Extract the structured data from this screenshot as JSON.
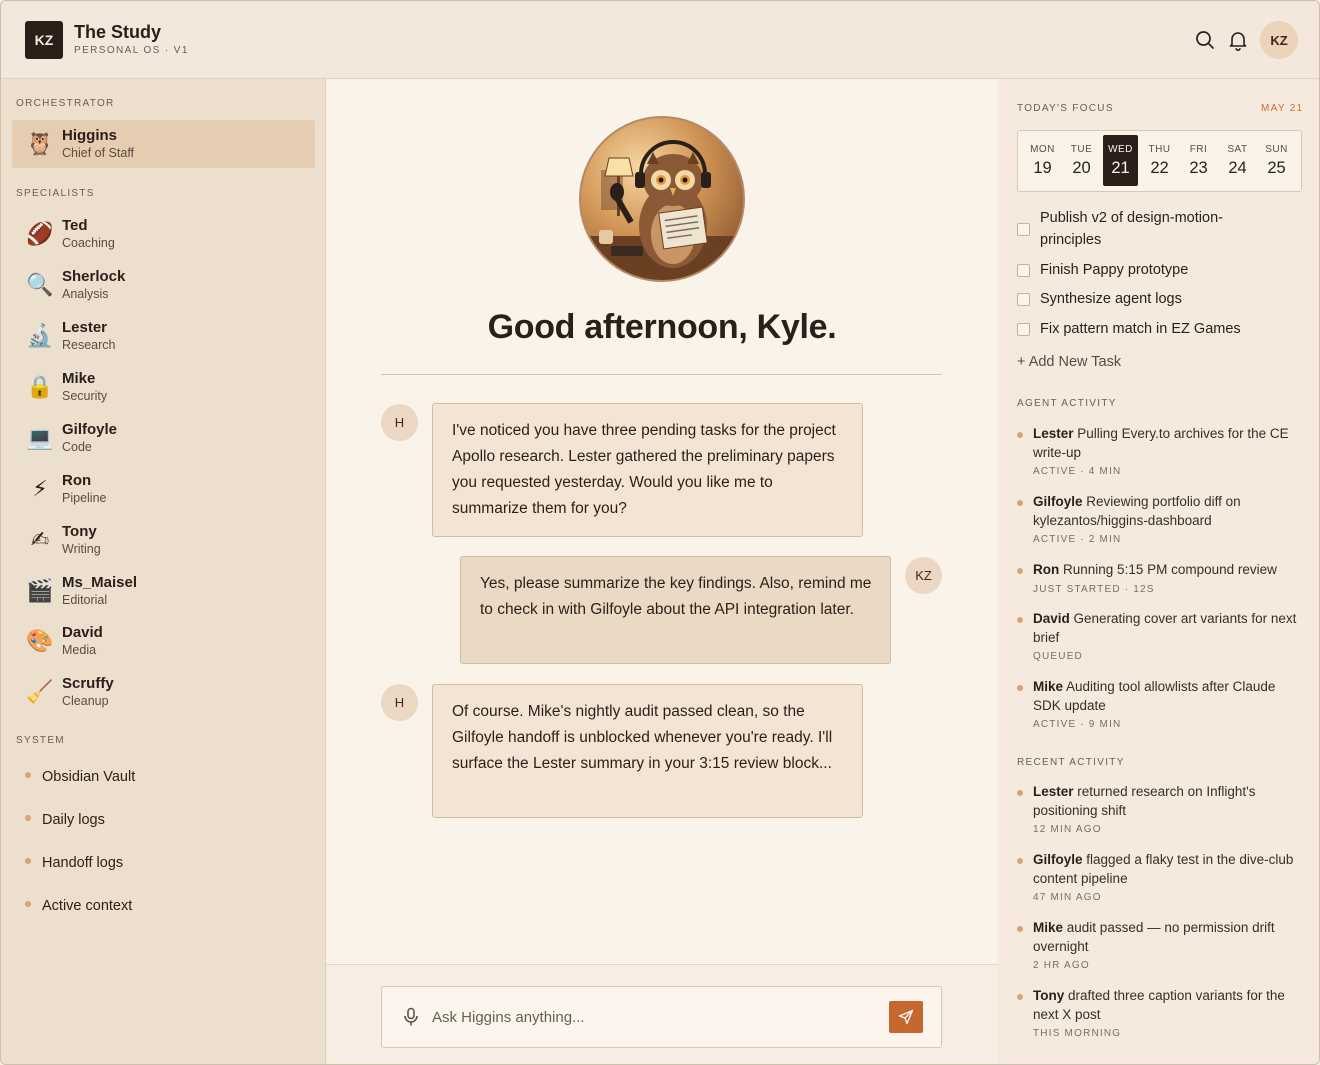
{
  "header": {
    "logo": "KZ",
    "title": "The Study",
    "subtitle": "PERSONAL OS · V1",
    "avatar": "KZ"
  },
  "sidebar": {
    "orchestrator_label": "ORCHESTRATOR",
    "orchestrator": {
      "name": "Higgins",
      "role": "Chief of Staff",
      "icon": "owl-icon"
    },
    "specialists_label": "SPECIALISTS",
    "specialists": [
      {
        "name": "Ted",
        "role": "Coaching",
        "icon": "football-icon"
      },
      {
        "name": "Sherlock",
        "role": "Analysis",
        "icon": "magnifier-icon"
      },
      {
        "name": "Lester",
        "role": "Research",
        "icon": "microscope-icon"
      },
      {
        "name": "Mike",
        "role": "Security",
        "icon": "lock-icon"
      },
      {
        "name": "Gilfoyle",
        "role": "Code",
        "icon": "laptop-icon"
      },
      {
        "name": "Ron",
        "role": "Pipeline",
        "icon": "lightning-icon"
      },
      {
        "name": "Tony",
        "role": "Writing",
        "icon": "writing-hand-icon"
      },
      {
        "name": "Ms_Maisel",
        "role": "Editorial",
        "icon": "clapper-icon"
      },
      {
        "name": "David",
        "role": "Media",
        "icon": "palette-icon"
      },
      {
        "name": "Scruffy",
        "role": "Cleanup",
        "icon": "broom-icon"
      }
    ],
    "system_label": "SYSTEM",
    "system": [
      "Obsidian Vault",
      "Daily logs",
      "Handoff logs",
      "Active context"
    ]
  },
  "main": {
    "greeting": "Good afternoon, Kyle.",
    "messages": [
      {
        "from": "H",
        "text": "I've noticed you have three pending tasks for the project Apollo research. Lester gathered the preliminary papers you requested yesterday. Would you like me to summarize them for you?"
      },
      {
        "from": "KZ",
        "text": "Yes, please summarize the key findings. Also, remind me to check in with Gilfoyle about the API integration later."
      },
      {
        "from": "H",
        "text": "Of course. Mike's nightly audit passed clean, so the Gilfoyle handoff is unblocked whenever you're ready. I'll surface the Lester summary in your 3:15 review block..."
      }
    ],
    "input_placeholder": "Ask Higgins anything..."
  },
  "right": {
    "focus_label": "TODAY'S FOCUS",
    "focus_date": "MAY 21",
    "days": [
      {
        "name": "MON",
        "num": "19"
      },
      {
        "name": "TUE",
        "num": "20"
      },
      {
        "name": "WED",
        "num": "21",
        "selected": true
      },
      {
        "name": "THU",
        "num": "22"
      },
      {
        "name": "FRI",
        "num": "23"
      },
      {
        "name": "SAT",
        "num": "24"
      },
      {
        "name": "SUN",
        "num": "25"
      }
    ],
    "tasks": [
      "Publish v2 of design-motion-principles",
      "Finish Pappy prototype",
      "Synthesize agent logs",
      "Fix pattern match in EZ Games"
    ],
    "add_task": "+ Add New Task",
    "agent_activity_label": "AGENT ACTIVITY",
    "agent_activity": [
      {
        "agent": "Lester",
        "text": "Pulling Every.to archives for the CE write-up",
        "meta": "ACTIVE · 4 MIN"
      },
      {
        "agent": "Gilfoyle",
        "text": "Reviewing portfolio diff on kylezantos/higgins-dashboard",
        "meta": "ACTIVE · 2 MIN"
      },
      {
        "agent": "Ron",
        "text": "Running 5:15 PM compound review",
        "meta": "JUST STARTED · 12S"
      },
      {
        "agent": "David",
        "text": "Generating cover art variants for next brief",
        "meta": "QUEUED"
      },
      {
        "agent": "Mike",
        "text": "Auditing tool allowlists after Claude SDK update",
        "meta": "ACTIVE · 9 MIN"
      }
    ],
    "recent_activity_label": "RECENT ACTIVITY",
    "recent_activity": [
      {
        "agent": "Lester",
        "text": "returned research on Inflight's positioning shift",
        "meta": "12 MIN AGO"
      },
      {
        "agent": "Gilfoyle",
        "text": "flagged a flaky test in the dive-club content pipeline",
        "meta": "47 MIN AGO"
      },
      {
        "agent": "Mike",
        "text": "audit passed — no permission drift overnight",
        "meta": "2 HR AGO"
      },
      {
        "agent": "Tony",
        "text": "drafted three caption variants for the next X post",
        "meta": "THIS MORNING"
      }
    ]
  },
  "colors": {
    "accent": "#c5672f",
    "date_accent": "#cf6d2e",
    "selected_day": "#2a1f19"
  }
}
